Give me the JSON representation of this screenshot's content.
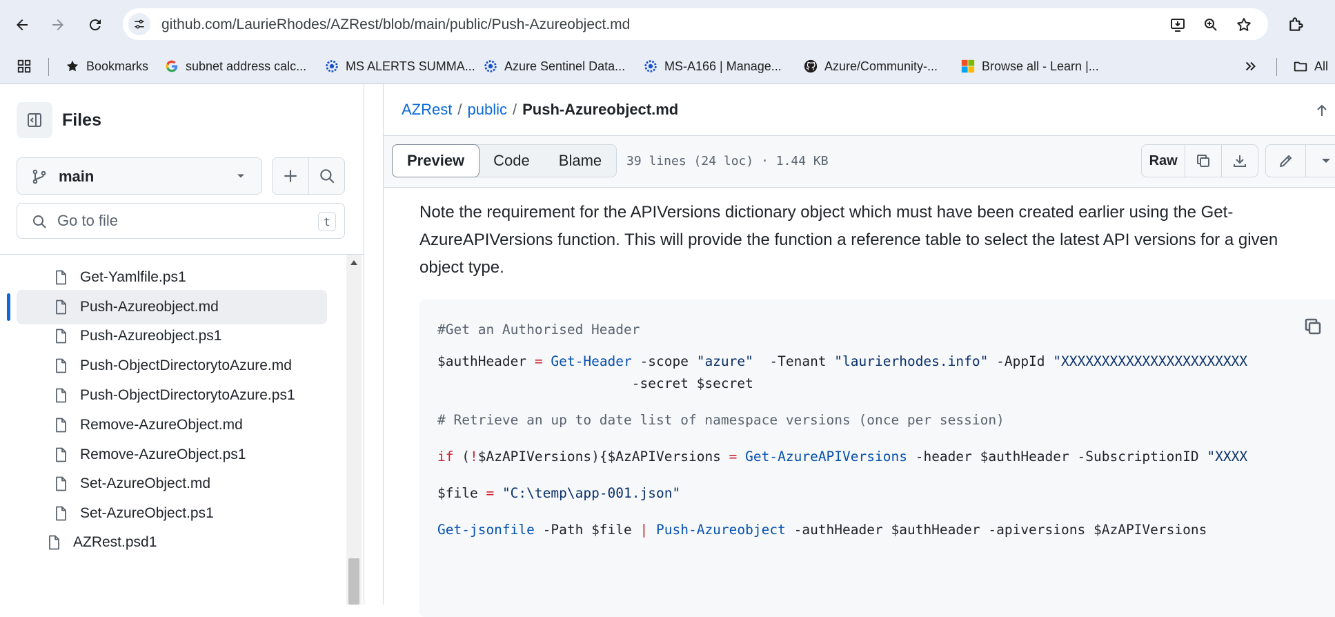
{
  "browser": {
    "url": "github.com/LaurieRhodes/AZRest/blob/main/public/Push-Azureobject.md",
    "bookmarks": [
      {
        "label": "Bookmarks",
        "icon": "star-icon"
      },
      {
        "label": "subnet address calc...",
        "icon": "google-icon"
      },
      {
        "label": "MS ALERTS SUMMA...",
        "icon": "gear-icon"
      },
      {
        "label": "Azure Sentinel Data...",
        "icon": "gear-icon"
      },
      {
        "label": "MS-A166 | Manage...",
        "icon": "gear-icon"
      },
      {
        "label": "Azure/Community-...",
        "icon": "github-icon"
      },
      {
        "label": "Browse all - Learn |...",
        "icon": "microsoft-icon"
      }
    ],
    "all_bookmarks_label": "All"
  },
  "sidebar": {
    "title": "Files",
    "branch": "main",
    "search_placeholder": "Go to file",
    "search_shortcut": "t",
    "files": [
      "Get-Yamlfile.ps1",
      "Push-Azureobject.md",
      "Push-Azureobject.ps1",
      "Push-ObjectDirectorytoAzure.md",
      "Push-ObjectDirectorytoAzure.ps1",
      "Remove-AzureObject.md",
      "Remove-AzureObject.ps1",
      "Set-AzureObject.md",
      "Set-AzureObject.ps1"
    ],
    "active_file_index": 1,
    "partial_item": "AZRest.psd1"
  },
  "main": {
    "breadcrumb": {
      "repo": "AZRest",
      "folder": "public",
      "file": "Push-Azureobject.md",
      "separator": "/"
    },
    "tabs": [
      "Preview",
      "Code",
      "Blame"
    ],
    "selected_tab": "Preview",
    "file_meta": "39 lines (24 loc) · 1.44 KB",
    "raw_label": "Raw",
    "prose": "Note the requirement for the APIVersions dictionary object which must have been created earlier using the Get-AzureAPIVersions function. This will provide the function a reference table to select the latest API versions for a given object type.",
    "code": {
      "l1": "#Get an Authorised Header",
      "l2_var": "$authHeader",
      "l2_eq": " = ",
      "l2_fn": "Get-Header",
      "l2_p1": " -scope ",
      "l2_s1": "\"azure\"",
      "l2_p2": "  -Tenant ",
      "l2_s2": "\"laurierhodes.info\"",
      "l2_p3": " -AppId ",
      "l2_s3": "\"XXXXXXXXXXXXXXXXXXXXXXX",
      "l3": "                        -secret $secret",
      "l4": "# Retrieve an up to date list of namespace versions (once per session)",
      "l5_if": "if",
      "l5_a": " (",
      "l5_bang": "!",
      "l5_b": "$AzAPIVersions){$AzAPIVersions",
      "l5_eq": " = ",
      "l5_fn": "Get-AzureAPIVersions",
      "l5_c": " -header $authHeader -SubscriptionID ",
      "l5_s": "\"XXXX",
      "l6_var": "$file",
      "l6_eq": " = ",
      "l6_s": "\"C:\\temp\\app-001.json\"",
      "l7_fn": "Get-jsonfile",
      "l7_a": " -Path $file ",
      "l7_pipe": "|",
      "l7_fn2": " Push-Azureobject",
      "l7_b": " -authHeader $authHeader -apiversions $AzAPIVersions"
    }
  },
  "colors": {
    "link": "#0969da",
    "string": "#0a3069",
    "function": "#0550ae",
    "keyword": "#cf222e",
    "comment": "#59636e"
  }
}
